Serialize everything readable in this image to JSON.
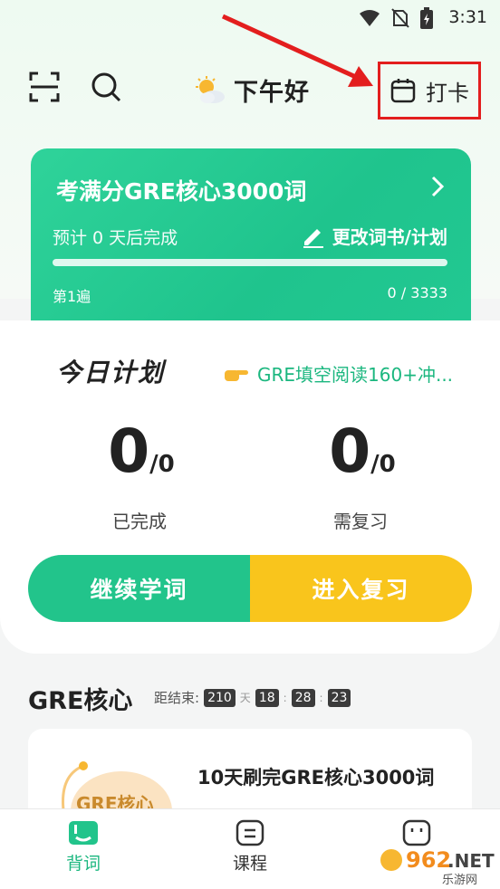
{
  "status_bar": {
    "time": "3:31"
  },
  "header": {
    "scan_icon": "scan-icon",
    "search_icon": "search-icon",
    "weather_icon": "sun-cloud-icon",
    "greeting": "下午好",
    "checkin_label": "打卡"
  },
  "book_card": {
    "title": "考满分GRE核心3000词",
    "estimate": "预计 0 天后完成",
    "edit_label": "更改词书/计划",
    "pass": "第1遍",
    "count": "0 / 3333",
    "progress": 0
  },
  "plan": {
    "title": "今日计划",
    "tip": "GRE填空阅读160+冲...",
    "completed": {
      "value": "0",
      "total": "/0",
      "label": "已完成"
    },
    "review": {
      "value": "0",
      "total": "/0",
      "label": "需复习"
    },
    "continue_label": "继续学词",
    "review_label": "进入复习"
  },
  "section": {
    "title": "GRE核心",
    "countdown_label": "距结束:",
    "days": "210",
    "days_unit": "天",
    "hours": "18",
    "minutes": "28",
    "seconds": "23",
    "course_badge": "GRE核心",
    "course_name": "10天刷完GRE核心3000词"
  },
  "nav": {
    "items": [
      {
        "label": "背词",
        "icon": "words-icon",
        "active": true
      },
      {
        "label": "课程",
        "icon": "course-icon",
        "active": false
      },
      {
        "label": "",
        "icon": "profile-icon",
        "active": false
      }
    ]
  },
  "watermark": {
    "text": "962.NET",
    "sub": "乐游网"
  },
  "colors": {
    "accent": "#22c48b",
    "review": "#f9c51c",
    "highlight": "#e31e1e"
  }
}
